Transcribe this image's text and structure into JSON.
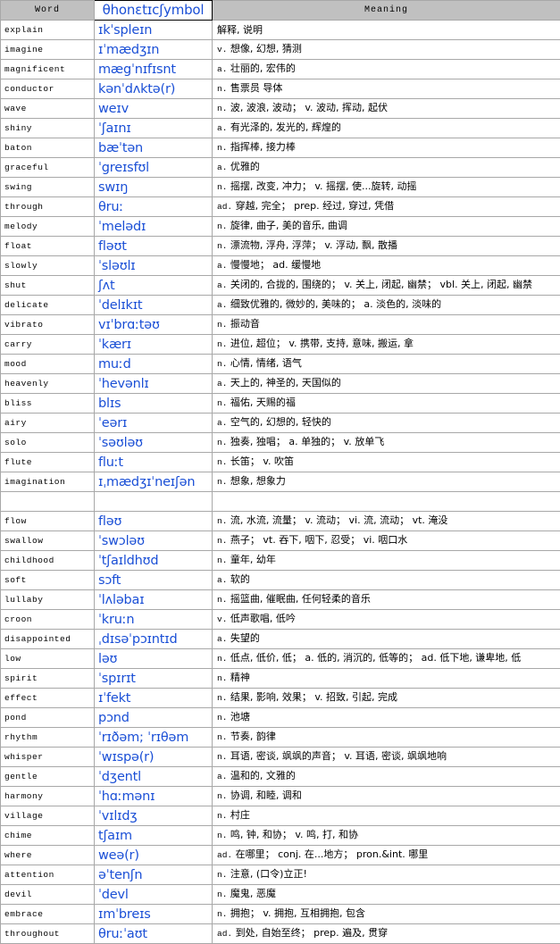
{
  "table": {
    "headers": {
      "word": "Word",
      "phonetic": "θhonɛtɪcʃymbol",
      "meaning": "Meaning"
    },
    "colors": {
      "header_background": "#c0c0c0",
      "phonetic_text": "#1a4fd6",
      "grid_line": "#a8a8a8",
      "text": "#000000",
      "page_background": "#ffffff"
    },
    "rows": [
      {
        "word": "explain",
        "phonetic": "ɪkˈspleɪn",
        "meaning": "解释, 说明"
      },
      {
        "word": "imagine",
        "phonetic": "ɪˈmædʒɪn",
        "meaning": "v.  想像, 幻想, 猜测"
      },
      {
        "word": "magnificent",
        "phonetic": "mægˈnɪfɪsnt",
        "meaning": "a.  壮丽的, 宏伟的"
      },
      {
        "word": "conductor",
        "phonetic": "kənˈdʌktə(r)",
        "meaning": "n.  售票员 导体"
      },
      {
        "word": "wave",
        "phonetic": "weɪv",
        "meaning": "n.  波, 波浪, 波动； v.  波动, 挥动, 起伏"
      },
      {
        "word": "shiny",
        "phonetic": "ˈʃaɪnɪ",
        "meaning": "a.  有光泽的, 发光的, 辉煌的"
      },
      {
        "word": "baton",
        "phonetic": "bæˈtən",
        "meaning": "n.  指挥棒, 接力棒"
      },
      {
        "word": "graceful",
        "phonetic": "ˈgreɪsfʊl",
        "meaning": "a.  优雅的"
      },
      {
        "word": "swing",
        "phonetic": "swɪŋ",
        "meaning": "n.  摇摆, 改变, 冲力； v.  摇摆, 使...旋转, 动摇"
      },
      {
        "word": "through",
        "phonetic": "θruː",
        "meaning": "ad.  穿越, 完全； prep.  经过, 穿过, 凭借"
      },
      {
        "word": "melody",
        "phonetic": "ˈmelədɪ",
        "meaning": "n.  旋律, 曲子, 美的音乐, 曲调"
      },
      {
        "word": "float",
        "phonetic": "fləʊt",
        "meaning": "n.  漂流物, 浮舟, 浮萍； v.  浮动, 飘, 散播"
      },
      {
        "word": "slowly",
        "phonetic": "ˈsləʊlɪ",
        "meaning": "a.  慢慢地； ad.  缓慢地"
      },
      {
        "word": "shut",
        "phonetic": "ʃʌt",
        "meaning": "a.  关闭的, 合拢的, 围绕的； v.  关上, 闭起, 幽禁； vbl.  关上, 闭起, 幽禁"
      },
      {
        "word": "delicate",
        "phonetic": "ˈdelɪkɪt",
        "meaning": "a.  细致优雅的, 微妙的, 美味的； a.  淡色的, 淡味的"
      },
      {
        "word": "vibrato",
        "phonetic": "vɪˈbrɑːtəʊ",
        "meaning": "n.  振动音"
      },
      {
        "word": "carry",
        "phonetic": "ˈkærɪ",
        "meaning": "n.  进位, 超位； v.  携带, 支持, 意味, 搬运, 拿"
      },
      {
        "word": "mood",
        "phonetic": "muːd",
        "meaning": "n.  心情, 情绪, 语气"
      },
      {
        "word": "heavenly",
        "phonetic": "ˈhevənlɪ",
        "meaning": "a.  天上的, 神圣的, 天国似的"
      },
      {
        "word": "bliss",
        "phonetic": "blɪs",
        "meaning": "n.  福佑, 天赐的福"
      },
      {
        "word": "airy",
        "phonetic": "ˈeərɪ",
        "meaning": "a.  空气的, 幻想的, 轻快的"
      },
      {
        "word": "solo",
        "phonetic": "ˈsəʊləʊ",
        "meaning": "n.  独奏, 独唱； a.  单独的； v.  放单飞"
      },
      {
        "word": "flute",
        "phonetic": "fluːt",
        "meaning": "n.  长笛； v.  吹笛"
      },
      {
        "word": "imagination",
        "phonetic": "ɪˌmædʒɪˈneɪʃən",
        "meaning": "n.  想象, 想象力"
      },
      {
        "word": "",
        "phonetic": "",
        "meaning": ""
      },
      {
        "word": "flow",
        "phonetic": "fləʊ",
        "meaning": "n.  流, 水流, 流量； v.  流动； vi.  流, 流动； vt.  淹没"
      },
      {
        "word": "swallow",
        "phonetic": "ˈswɔləʊ",
        "meaning": "n.  燕子； vt.  吞下, 咽下, 忍受； vi.  咽口水"
      },
      {
        "word": "childhood",
        "phonetic": "ˈtʃaɪldhʊd",
        "meaning": "n.  童年, 幼年"
      },
      {
        "word": "soft",
        "phonetic": "sɔft",
        "meaning": "a.  软的"
      },
      {
        "word": "lullaby",
        "phonetic": "ˈlʌləbaɪ",
        "meaning": "n.  摇篮曲, 催眠曲, 任何轻柔的音乐"
      },
      {
        "word": "croon",
        "phonetic": "ˈkruːn",
        "meaning": "v.  低声歌唱, 低吟"
      },
      {
        "word": "disappointed",
        "phonetic": "ˌdɪsəˈpɔɪntɪd",
        "meaning": "a.  失望的"
      },
      {
        "word": "low",
        "phonetic": "ləʊ",
        "meaning": "n.  低点, 低价, 低； a.  低的, 消沉的, 低等的； ad.  低下地, 谦卑地, 低"
      },
      {
        "word": "spirit",
        "phonetic": "ˈspɪrɪt",
        "meaning": "n.  精神"
      },
      {
        "word": "effect",
        "phonetic": "ɪˈfekt",
        "meaning": "n.  结果, 影响, 效果； v.  招致, 引起, 完成"
      },
      {
        "word": "pond",
        "phonetic": "pɔnd",
        "meaning": "n.  池塘"
      },
      {
        "word": "rhythm",
        "phonetic": "ˈrɪðəm; ˈrɪθəm",
        "meaning": "n.  节奏, 韵律"
      },
      {
        "word": "whisper",
        "phonetic": "ˈwɪspə(r)",
        "meaning": "n.  耳语, 密谈, 飒飒的声音； v.  耳语, 密谈, 飒飒地响"
      },
      {
        "word": "gentle",
        "phonetic": "ˈdʒentl",
        "meaning": "a.  温和的, 文雅的"
      },
      {
        "word": "harmony",
        "phonetic": "ˈhɑːmənɪ",
        "meaning": "n.  协调, 和睦, 调和"
      },
      {
        "word": "village",
        "phonetic": "ˈvɪlɪdʒ",
        "meaning": "n.  村庄"
      },
      {
        "word": "chime",
        "phonetic": "tʃaɪm",
        "meaning": "n.  鸣, 钟, 和协； v.  鸣, 打, 和协"
      },
      {
        "word": "where",
        "phonetic": "weə(r)",
        "meaning": "ad.  在哪里； conj.  在...地方； pron.&int.  哪里"
      },
      {
        "word": "attention",
        "phonetic": "əˈtenʃn",
        "meaning": "n.  注意, (口令)立正!"
      },
      {
        "word": "devil",
        "phonetic": "ˈdevl",
        "meaning": "n.  魔鬼, 恶魔"
      },
      {
        "word": "embrace",
        "phonetic": "ɪmˈbreɪs",
        "meaning": "n.  拥抱； v.  拥抱, 互相拥抱, 包含"
      },
      {
        "word": "throughout",
        "phonetic": "θruːˈaʊt",
        "meaning": "ad.  到处, 自始至终； prep.  遍及, 贯穿"
      }
    ]
  }
}
